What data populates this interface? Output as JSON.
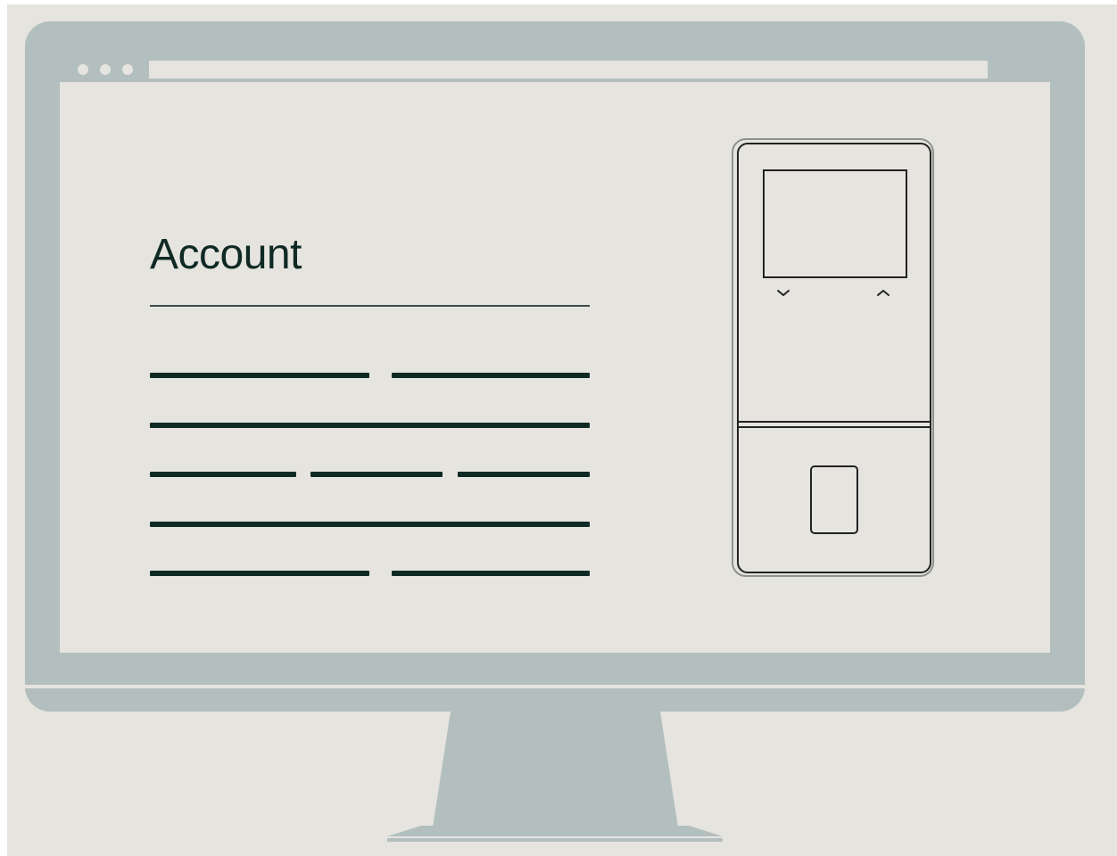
{
  "page": {
    "title": "Account"
  },
  "colors": {
    "background": "#e6e4df",
    "monitor_frame": "#b2bfbe",
    "title_text": "#0f2a24",
    "placeholder_lines": "#0f2a24",
    "device_outline": "#222222"
  },
  "icons": {
    "window_controls": [
      "window-dot-icon",
      "window-dot-icon",
      "window-dot-icon"
    ],
    "device_down": "chevron-down-icon",
    "device_up": "chevron-up-icon",
    "fingerprint": "fingerprint-sensor-icon"
  }
}
